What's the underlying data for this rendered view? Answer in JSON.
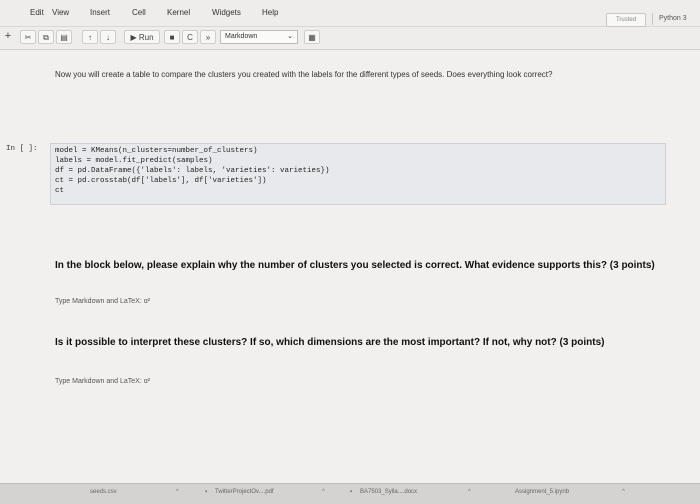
{
  "menu": {
    "items": [
      "Edit",
      "View",
      "Insert",
      "Cell",
      "Kernel",
      "Widgets",
      "Help"
    ],
    "trusted": "Trusted",
    "kernel": "Python 3"
  },
  "toolbar": {
    "run_label": "Run",
    "cell_type": "Markdown"
  },
  "notebook": {
    "intro": "Now you will create a table to compare the clusters you created with the labels for the different types of seeds. Does everything look correct?",
    "prompt": "In [ ]:",
    "code": "model = KMeans(n_clusters=number_of_clusters)\nlabels = model.fit_predict(samples)\ndf = pd.DataFrame({'labels': labels, 'varieties': varieties})\nct = pd.crosstab(df['labels'], df['varieties'])\nct",
    "q1": "In the block below, please explain why the number of clusters you selected is correct. What evidence supports this? (3 points)",
    "q1_hint": "Type Markdown and LaTeX: α²",
    "q2": "Is it possible to interpret these clusters? If so, which dimensions are the most important? If not, why not? (3 points)",
    "q2_hint": "Type Markdown and LaTeX: α²"
  },
  "downloads": [
    "seeds.csv",
    "TwitterProjectOv....pdf",
    "BA7503_Sylla....docx",
    "Assignment_5.ipynb"
  ]
}
